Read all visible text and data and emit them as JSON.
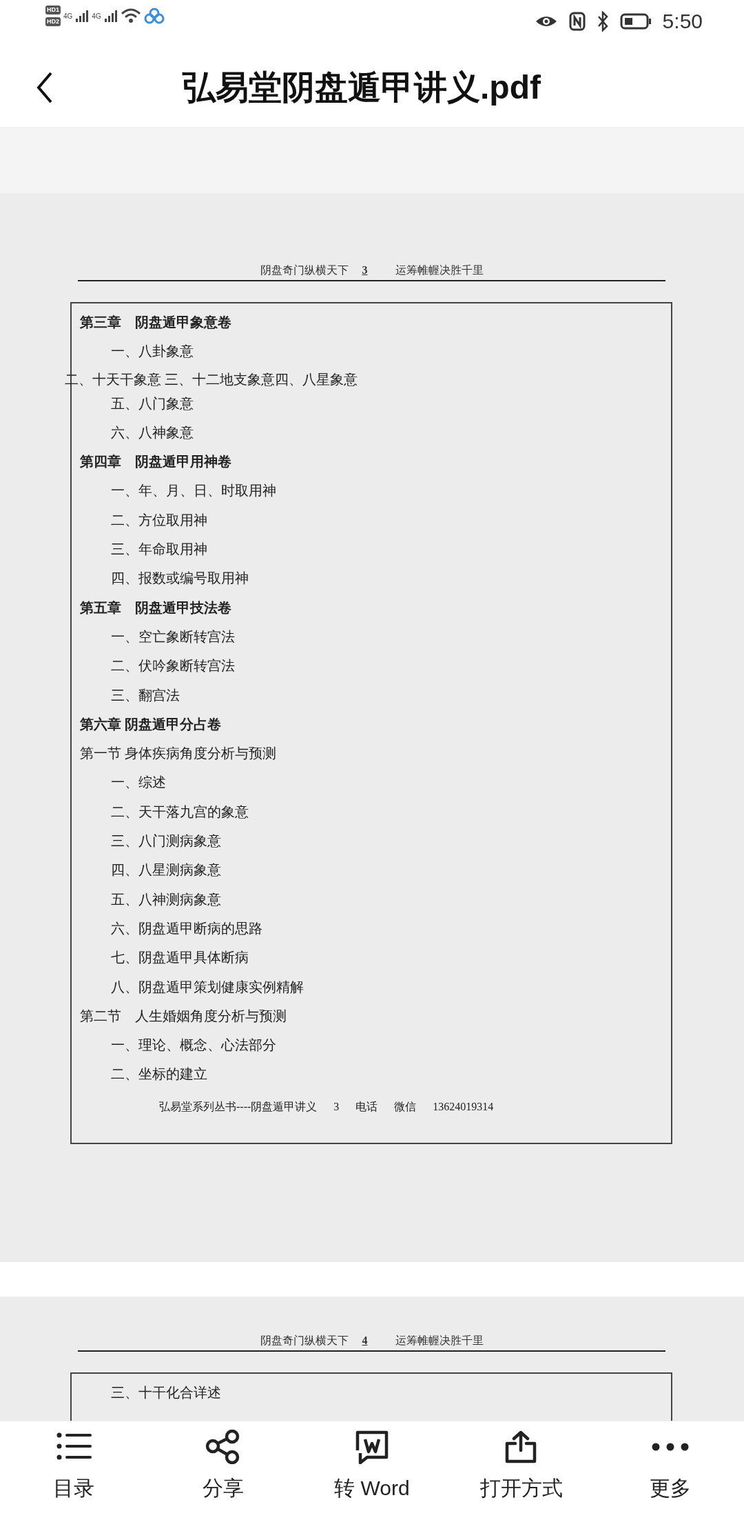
{
  "status_bar": {
    "sim_badges": [
      "HD1",
      "HD2"
    ],
    "network_labels": [
      "4G",
      "4G"
    ],
    "time": "5:50"
  },
  "app_bar": {
    "title": "弘易堂阴盘遁甲讲义.pdf"
  },
  "pages": [
    {
      "header_left": "阴盘奇门纵横天下",
      "page_number": "3",
      "header_right": "运筹帷幄决胜千里",
      "entries": [
        {
          "kind": "chapter",
          "text": "第三章　阴盘遁甲象意卷"
        },
        {
          "kind": "item",
          "text": "一、八卦象意"
        },
        {
          "kind": "misplaced",
          "text": "二、十天干象意 三、十二地支象意四、八星象意"
        },
        {
          "kind": "item",
          "text": "五、八门象意"
        },
        {
          "kind": "item",
          "text": "六、八神象意"
        },
        {
          "kind": "chapter",
          "text": "第四章　阴盘遁甲用神卷"
        },
        {
          "kind": "item",
          "text": "一、年、月、日、时取用神"
        },
        {
          "kind": "item",
          "text": "二、方位取用神"
        },
        {
          "kind": "item",
          "text": "三、年命取用神"
        },
        {
          "kind": "item",
          "text": "四、报数或编号取用神"
        },
        {
          "kind": "chapter",
          "text": "第五章　阴盘遁甲技法卷"
        },
        {
          "kind": "item",
          "text": "一、空亡象断转宫法"
        },
        {
          "kind": "item",
          "text": "二、伏吟象断转宫法"
        },
        {
          "kind": "item",
          "text": "三、翻宫法"
        },
        {
          "kind": "chapter",
          "text": "第六章 阴盘遁甲分占卷"
        },
        {
          "kind": "section",
          "text": "第一节 身体疾病角度分析与预测"
        },
        {
          "kind": "item",
          "text": "一、综述"
        },
        {
          "kind": "item",
          "text": "二、天干落九宫的象意"
        },
        {
          "kind": "item",
          "text": "三、八门测病象意"
        },
        {
          "kind": "item",
          "text": "四、八星测病象意"
        },
        {
          "kind": "item",
          "text": "五、八神测病象意"
        },
        {
          "kind": "item",
          "text": "六、阴盘遁甲断病的思路"
        },
        {
          "kind": "item",
          "text": "七、阴盘遁甲具体断病"
        },
        {
          "kind": "item",
          "text": "八、阴盘遁甲策划健康实例精解"
        },
        {
          "kind": "section",
          "text": "第二节　人生婚姻角度分析与预测"
        },
        {
          "kind": "item",
          "text": "一、理论、概念、心法部分"
        },
        {
          "kind": "item",
          "text": "二、坐标的建立"
        }
      ],
      "footer": [
        "弘易堂系列丛书----阴盘遁甲讲义",
        "3",
        "电话",
        "微信",
        "13624019314"
      ]
    },
    {
      "header_left": "阴盘奇门纵横天下",
      "page_number": "4",
      "header_right": "运筹帷幄决胜千里",
      "entries": [
        {
          "kind": "item",
          "text": "三、十干化合详述"
        }
      ]
    }
  ],
  "toolbar": [
    {
      "kind": "list",
      "label": "目录"
    },
    {
      "kind": "share",
      "label": "分享"
    },
    {
      "kind": "word",
      "label": "转 Word"
    },
    {
      "kind": "export",
      "label": "打开方式"
    },
    {
      "kind": "more",
      "label": "更多"
    }
  ]
}
